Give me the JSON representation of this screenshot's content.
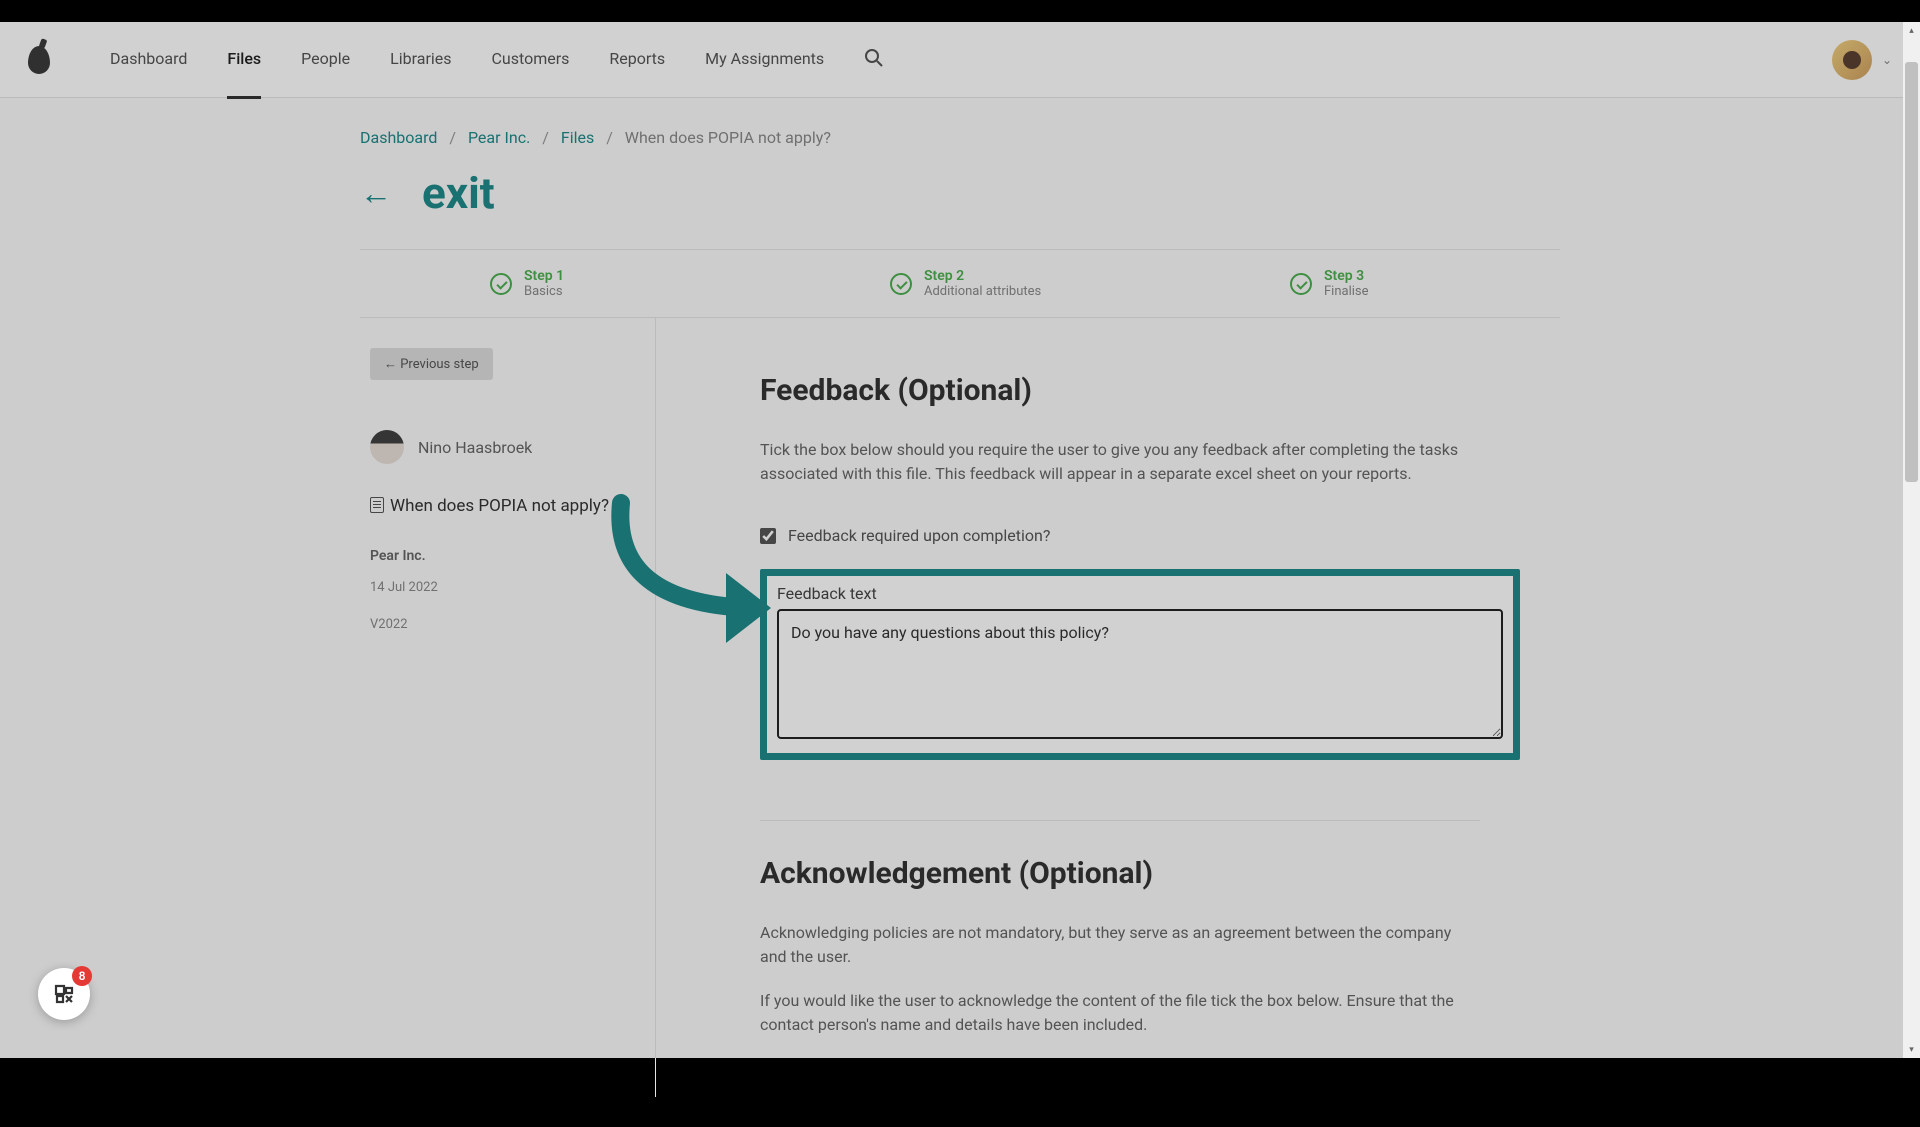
{
  "nav": {
    "items": [
      "Dashboard",
      "Files",
      "People",
      "Libraries",
      "Customers",
      "Reports",
      "My Assignments"
    ],
    "active_index": 1
  },
  "breadcrumb": {
    "items": [
      "Dashboard",
      "Pear Inc.",
      "Files"
    ],
    "current": "When does POPIA not apply?",
    "sep": "/"
  },
  "exit": {
    "label": "exit",
    "back": "←"
  },
  "steps": [
    {
      "title": "Step 1",
      "sub": "Basics"
    },
    {
      "title": "Step 2",
      "sub": "Additional attributes"
    },
    {
      "title": "Step 3",
      "sub": "Finalise"
    }
  ],
  "left": {
    "prev_btn": "← Previous step",
    "author": "Nino Haasbroek",
    "file_title": "When does POPIA not apply?",
    "company": "Pear Inc.",
    "date": "14 Jul 2022",
    "version": "V2022"
  },
  "feedback": {
    "heading": "Feedback (Optional)",
    "desc": "Tick the box below should you require the user to give you any feedback after completing the tasks associated with this file. This feedback will appear in a separate excel sheet on your reports.",
    "checkbox_label": "Feedback required upon completion?",
    "checked": true,
    "text_label": "Feedback text",
    "text_value": "Do you have any questions about this policy?"
  },
  "ack": {
    "heading": "Acknowledgement (Optional)",
    "desc1": "Acknowledging policies are not mandatory, but they serve as an agreement between the company and the user.",
    "desc2": "If you would like the user to acknowledge the content of the file tick the box below. Ensure that the contact person's name and details have been included."
  },
  "widget": {
    "badge": "8"
  }
}
